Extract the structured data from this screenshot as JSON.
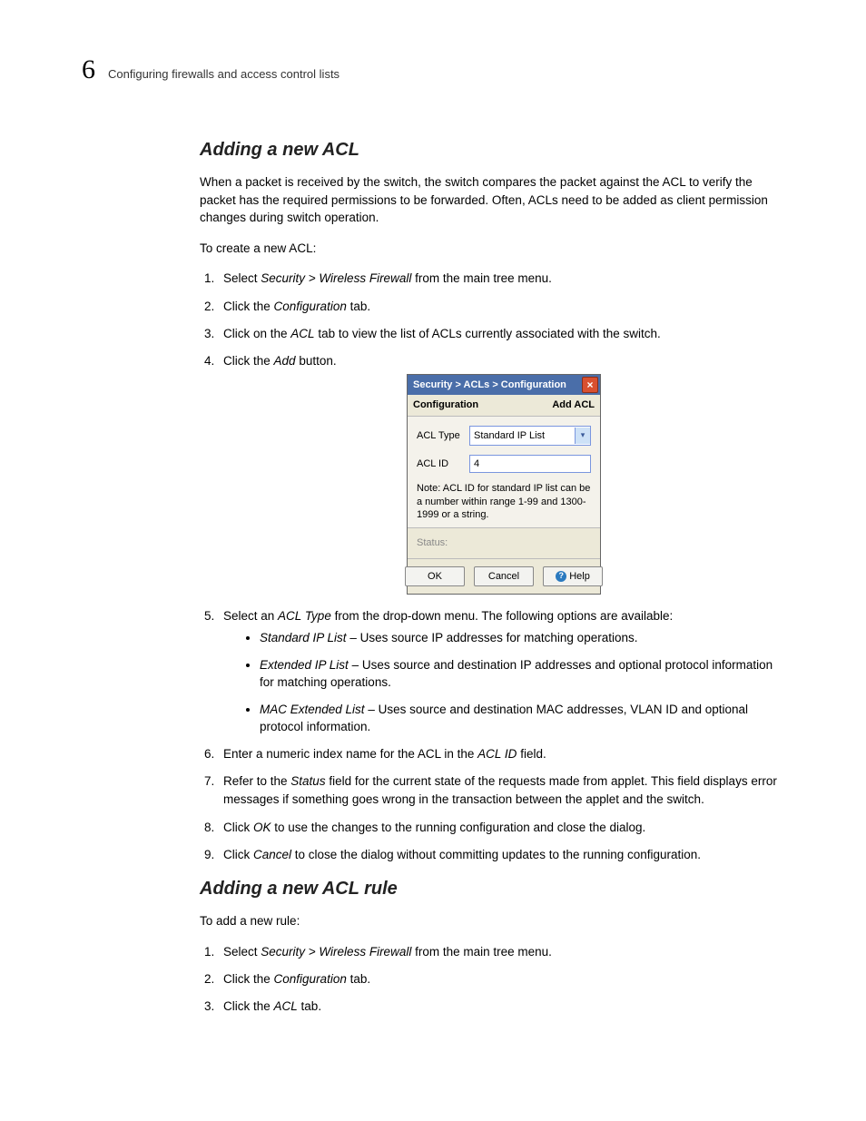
{
  "header": {
    "page_number": "6",
    "title": "Configuring firewalls and access control lists"
  },
  "section1": {
    "title": "Adding a new ACL",
    "intro": "When a packet is received by the switch, the switch compares the packet against the ACL to verify the packet has the required permissions to be forwarded. Often, ACLs need to be added as client permission changes during switch operation.",
    "lead": "To create a new ACL:",
    "step1_a": "Select ",
    "step1_em": "Security > Wireless Firewall",
    "step1_b": " from the main tree menu.",
    "step2_a": "Click the ",
    "step2_em": "Configuration",
    "step2_b": " tab.",
    "step3_a": "Click on the ",
    "step3_em": "ACL",
    "step3_b": " tab to view the list of ACLs currently associated with the switch.",
    "step4_a": "Click the ",
    "step4_em": "Add",
    "step4_b": " button.",
    "step5_a": "Select an ",
    "step5_em": "ACL Type",
    "step5_b": " from the drop-down menu. The following options are available:",
    "b1_em": "Standard IP List",
    "b1_t": " – Uses source IP addresses for matching operations.",
    "b2_em": "Extended IP List",
    "b2_t": " – Uses source and destination IP addresses and optional protocol information for matching operations.",
    "b3_em": "MAC Extended List",
    "b3_t": " – Uses source and destination MAC addresses, VLAN ID and optional protocol information.",
    "step6_a": "Enter a numeric index name for the ACL in the ",
    "step6_em": "ACL ID",
    "step6_b": " field.",
    "step7_a": "Refer to the ",
    "step7_em": "Status",
    "step7_b": " field for the current state of the requests made from applet. This field displays error messages if something goes wrong in the transaction between the applet and the switch.",
    "step8_a": "Click ",
    "step8_em": "OK",
    "step8_b": " to use the changes to the running configuration and close the dialog.",
    "step9_a": "Click ",
    "step9_em": "Cancel",
    "step9_b": " to close the dialog without committing updates to the running configuration."
  },
  "dialog": {
    "title": "Security > ACLs > Configuration",
    "sub_left": "Configuration",
    "sub_right": "Add ACL",
    "lbl_type": "ACL Type",
    "val_type": "Standard IP List",
    "lbl_id": "ACL ID",
    "val_id": "4",
    "note": "Note: ACL ID for standard IP list can be a number within range 1-99 and 1300-1999 or a string.",
    "status_label": "Status:",
    "btn_ok": "OK",
    "btn_cancel": "Cancel",
    "btn_help": "Help"
  },
  "section2": {
    "title": "Adding a new ACL rule",
    "lead": "To add a new rule:",
    "step1_a": "Select ",
    "step1_em": "Security > Wireless Firewall",
    "step1_b": " from the main tree menu.",
    "step2_a": "Click the ",
    "step2_em": "Configuration",
    "step2_b": " tab.",
    "step3_a": "Click the ",
    "step3_em": "ACL",
    "step3_b": " tab."
  }
}
